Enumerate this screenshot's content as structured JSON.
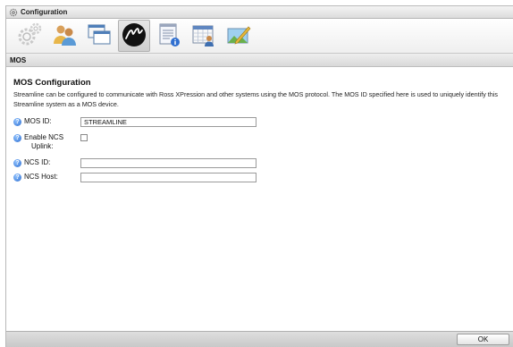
{
  "window": {
    "title": "Configuration"
  },
  "toolbar": {
    "items": [
      {
        "icon": "gears-icon",
        "active": false
      },
      {
        "icon": "users-icon",
        "active": false
      },
      {
        "icon": "windows-icon",
        "active": false
      },
      {
        "icon": "mos-logo-icon",
        "active": true
      },
      {
        "icon": "notepad-info-icon",
        "active": false
      },
      {
        "icon": "calendar-user-icon",
        "active": false
      },
      {
        "icon": "picture-pen-icon",
        "active": false
      }
    ]
  },
  "section": {
    "title": "MOS"
  },
  "panel": {
    "heading": "MOS Configuration",
    "description": "Streamline can be configured to communicate with Ross XPression and other systems using the MOS protocol. The MOS ID specified here is used to uniquely identify this Streamline system as a MOS device."
  },
  "form": {
    "help_glyph": "?",
    "mos_id": {
      "label": "MOS ID:",
      "value": "STREAMLINE"
    },
    "enable_ncs": {
      "label_line1": "Enable NCS",
      "label_line2": "Uplink:",
      "checked": false
    },
    "ncs_id": {
      "label": "NCS ID:",
      "value": ""
    },
    "ncs_host": {
      "label": "NCS Host:",
      "value": ""
    }
  },
  "footer": {
    "ok_label": "OK"
  },
  "colors": {
    "accent": "#2f6fd0",
    "toolbar_bg": "#efefef",
    "border": "#b9b9b9"
  }
}
